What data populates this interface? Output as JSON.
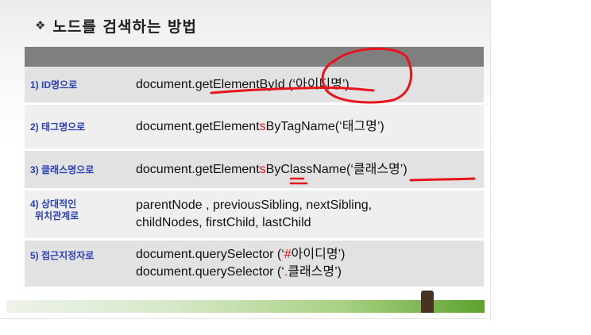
{
  "slide": {
    "bullet_glyph": "❖",
    "title": "노드를 검색하는 방법"
  },
  "rows": [
    {
      "label": "1) ID명으로",
      "code_lines": [
        {
          "parts": [
            {
              "text": "document.getElementById (‘아이디명’)",
              "red": false
            }
          ]
        }
      ]
    },
    {
      "label": "2) 태그명으로",
      "code_lines": [
        {
          "parts": [
            {
              "text": "document.getElement",
              "red": false
            },
            {
              "text": "s",
              "red": true
            },
            {
              "text": "ByTagName(‘태그명’)",
              "red": false
            }
          ]
        }
      ]
    },
    {
      "label": "3) 클래스명으로",
      "code_lines": [
        {
          "parts": [
            {
              "text": "document.getElement",
              "red": false
            },
            {
              "text": "s",
              "red": true
            },
            {
              "text": "ByClassName(‘클래스명’)",
              "red": false
            }
          ]
        }
      ]
    },
    {
      "label_lines": [
        "4) 상대적인",
        "위치관계로"
      ],
      "code_lines": [
        {
          "parts": [
            {
              "text": "parentNode , previousSibling, nextSibling,",
              "red": false
            }
          ]
        },
        {
          "parts": [
            {
              "text": "childNodes, firstChild, lastChild",
              "red": false
            }
          ]
        }
      ]
    },
    {
      "label": "5) 접근지정자로",
      "code_lines": [
        {
          "parts": [
            {
              "text": "document.querySelector (‘",
              "red": false
            },
            {
              "text": "#",
              "red": true
            },
            {
              "text": "아이디명’)",
              "red": false
            }
          ]
        },
        {
          "parts": [
            {
              "text": "document.querySelector (‘",
              "red": false
            },
            {
              "text": ".",
              "red": true
            },
            {
              "text": "클래스명’)",
              "red": false
            }
          ]
        }
      ]
    }
  ],
  "colors": {
    "label_blue": "#2a42b5",
    "highlight_red": "#e5101c",
    "header_gray": "#7f7f7f",
    "annotation_red": "#e8141c"
  }
}
